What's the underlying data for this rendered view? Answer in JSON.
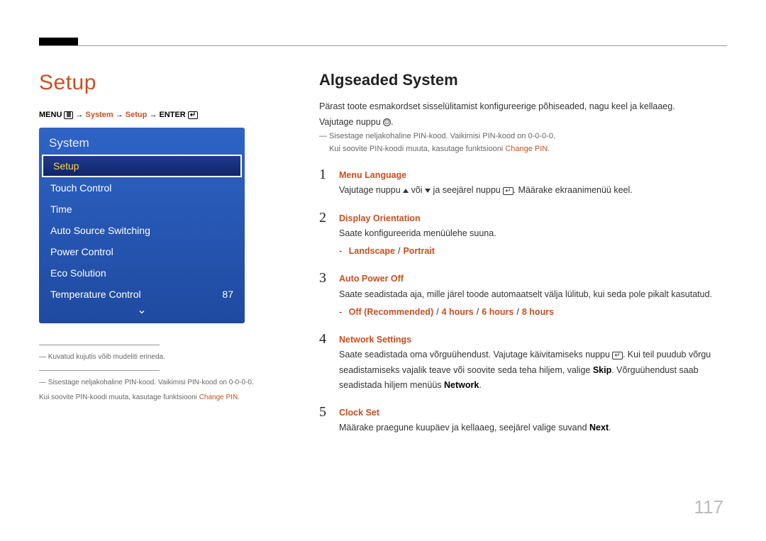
{
  "page_number": "117",
  "left": {
    "title": "Setup",
    "breadcrumb": {
      "menu": "MENU",
      "arrow": "→",
      "system": "System",
      "setup": "Setup",
      "enter": "ENTER"
    },
    "osd": {
      "title": "System",
      "items": [
        {
          "label": "Setup",
          "value": "",
          "selected": true
        },
        {
          "label": "Touch Control",
          "value": "",
          "selected": false
        },
        {
          "label": "Time",
          "value": "",
          "selected": false
        },
        {
          "label": "Auto Source Switching",
          "value": "",
          "selected": false
        },
        {
          "label": "Power Control",
          "value": "",
          "selected": false
        },
        {
          "label": "Eco Solution",
          "value": "",
          "selected": false
        },
        {
          "label": "Temperature Control",
          "value": "87",
          "selected": false
        }
      ]
    },
    "footnotes": {
      "line1": "― Kuvatud kujutis võib mudeliti erineda.",
      "line2a": "― Sisestage neljakohaline PIN-kood. Vaikimisi PIN-kood on 0-0-0-0.",
      "line2b_prefix": "Kui soovite PIN-koodi muuta, kasutage funktsiooni ",
      "line2b_accent": "Change PIN",
      "line2b_suffix": "."
    }
  },
  "right": {
    "heading": "Algseaded System",
    "intro1": "Pärast toote esmakordset sisselülitamist konfigureerige põhiseaded, nagu keel ja kellaaeg.",
    "intro2_prefix": "Vajutage nuppu ",
    "intro2_suffix": ".",
    "note1": "― Sisestage neljakohaline PIN-kood. Vaikimisi PIN-kood on 0-0-0-0.",
    "note2_prefix": "Kui soovite PIN-koodi muuta, kasutage funktsiooni ",
    "note2_accent": "Change PIN",
    "note2_suffix": ".",
    "steps": [
      {
        "num": "1",
        "title": "Menu Language",
        "body_prefix": "Vajutage nuppu ",
        "body_mid": " või ",
        "body_mid2": " ja seejärel nuppu ",
        "body_suffix": ". Määrake ekraanimenüü keel."
      },
      {
        "num": "2",
        "title": "Display Orientation",
        "body": "Saate konfigureerida menüülehe suuna.",
        "options": [
          "Landscape",
          "Portrait"
        ]
      },
      {
        "num": "3",
        "title": "Auto Power Off",
        "body": "Saate seadistada aja, mille järel toode automaatselt välja lülitub, kui seda pole pikalt kasutatud.",
        "options": [
          "Off (Recommended)",
          "4 hours",
          "6 hours",
          "8 hours"
        ]
      },
      {
        "num": "4",
        "title": "Network Settings",
        "body_prefix": "Saate seadistada oma võrguühendust. Vajutage käivitamiseks nuppu ",
        "body_mid": ". Kui teil puudub võrgu seadistamiseks vajalik teave või soovite seda teha hiljem, valige ",
        "skip": "Skip",
        "body_mid2": ". Võrguühendust saab seadistada hiljem menüüs ",
        "network": "Network",
        "body_suffix": "."
      },
      {
        "num": "5",
        "title": "Clock Set",
        "body_prefix": "Määrake praegune kuupäev ja kellaaeg, seejärel valige suvand ",
        "next": "Next",
        "body_suffix": "."
      }
    ]
  }
}
